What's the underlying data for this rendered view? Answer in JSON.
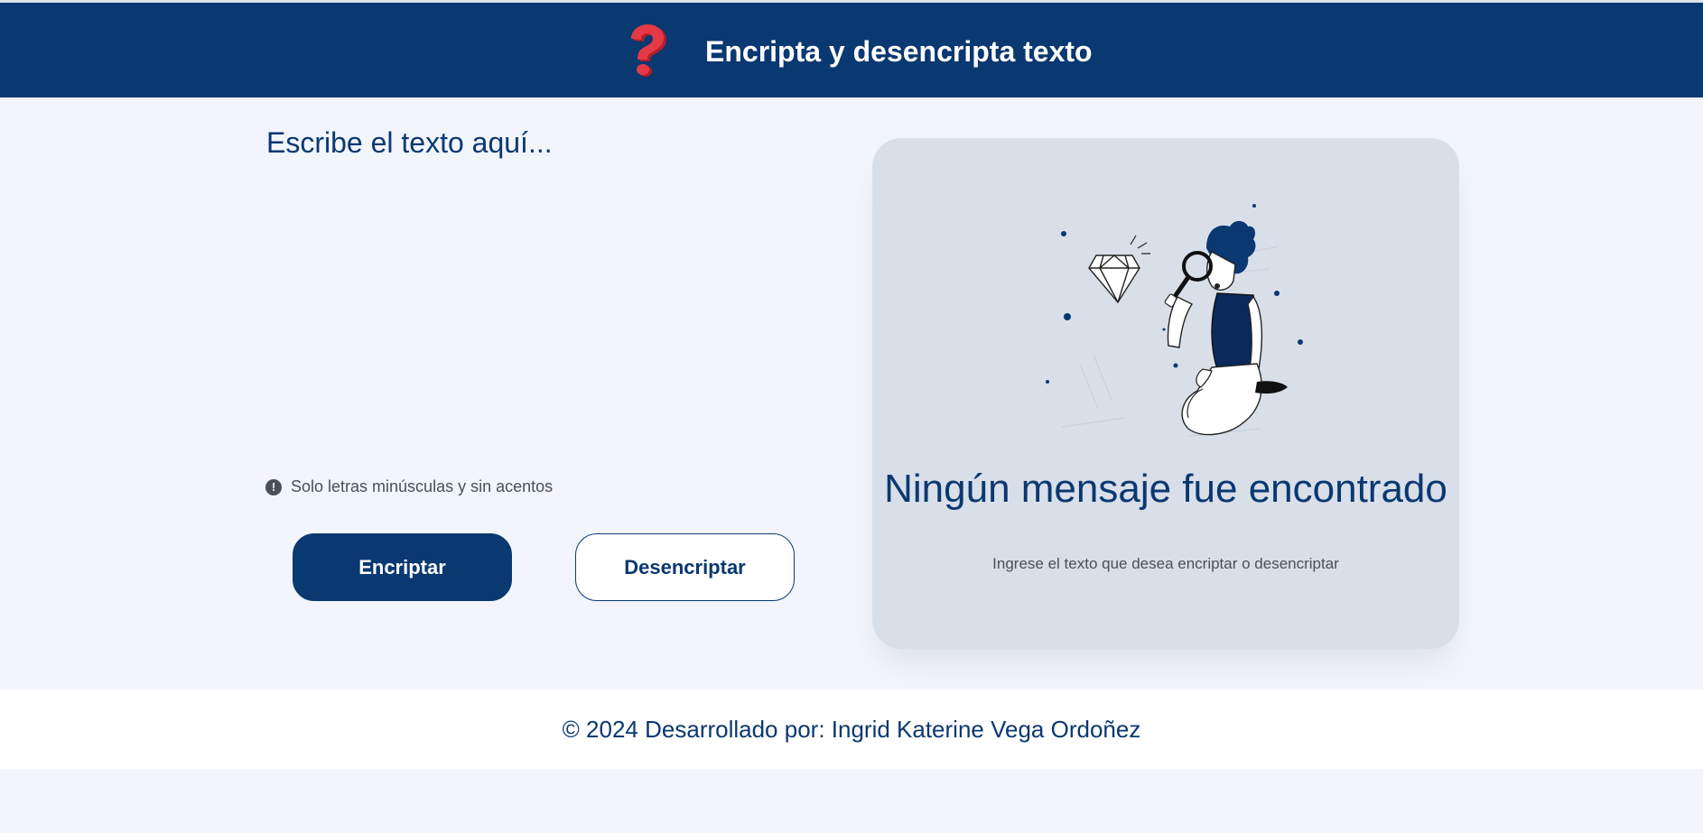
{
  "header": {
    "logo_icon": "question-mark-icon",
    "title": "Encripta y desencripta texto"
  },
  "input": {
    "placeholder": "Escribe el texto aquí...",
    "value": ""
  },
  "hint": {
    "icon": "exclamation-circle-icon",
    "text": "Solo letras minúsculas y sin acentos"
  },
  "buttons": {
    "encrypt_label": "Encriptar",
    "decrypt_label": "Desencriptar"
  },
  "output": {
    "illustration": "person-with-magnifying-glass-and-diamond",
    "title": "Ningún mensaje fue encontrado",
    "subtitle": "Ingrese el texto que desea encriptar o desencriptar"
  },
  "footer": {
    "text": "© 2024 Desarrollado por: Ingrid Katerine Vega Ordoñez"
  },
  "colors": {
    "primary": "#0a3871",
    "background": "#f2f5fc",
    "card": "#d9dfe9",
    "accent_logo": "#e63946"
  }
}
